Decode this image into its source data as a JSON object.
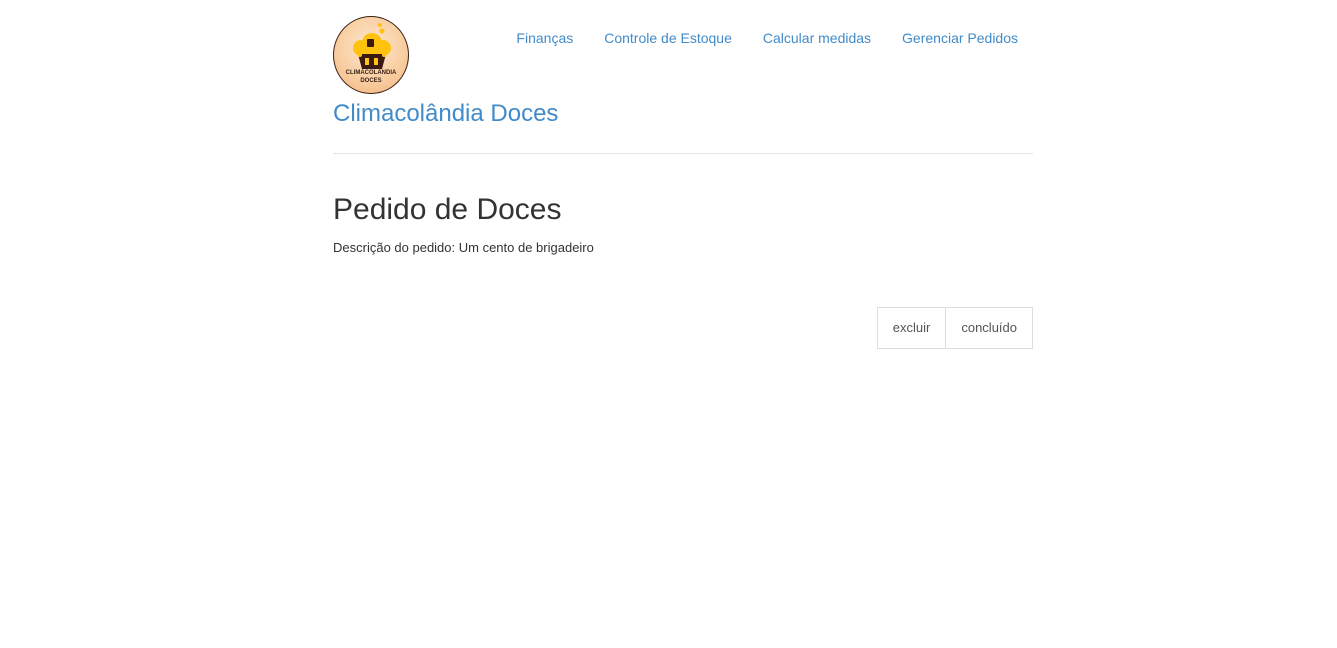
{
  "logo": {
    "line1": "CLIMACOLÂNDIA",
    "line2": "DOCES",
    "colors": {
      "bg": "#f9cfa3",
      "cupcake_top": "#ffc20e",
      "cupcake_base": "#3b1a12"
    }
  },
  "nav": {
    "items": [
      {
        "label": "Finanças"
      },
      {
        "label": "Controle de Estoque"
      },
      {
        "label": "Calcular medidas"
      },
      {
        "label": "Gerenciar Pedidos"
      }
    ]
  },
  "brand": {
    "title": "Climacolândia Doces"
  },
  "main": {
    "title": "Pedido de Doces",
    "description": "Descrição do pedido: Um cento de brigadeiro"
  },
  "actions": {
    "delete_label": "excluir",
    "done_label": "concluído"
  },
  "colors": {
    "link": "#428bca",
    "text": "#333333",
    "border": "#dddddd"
  }
}
